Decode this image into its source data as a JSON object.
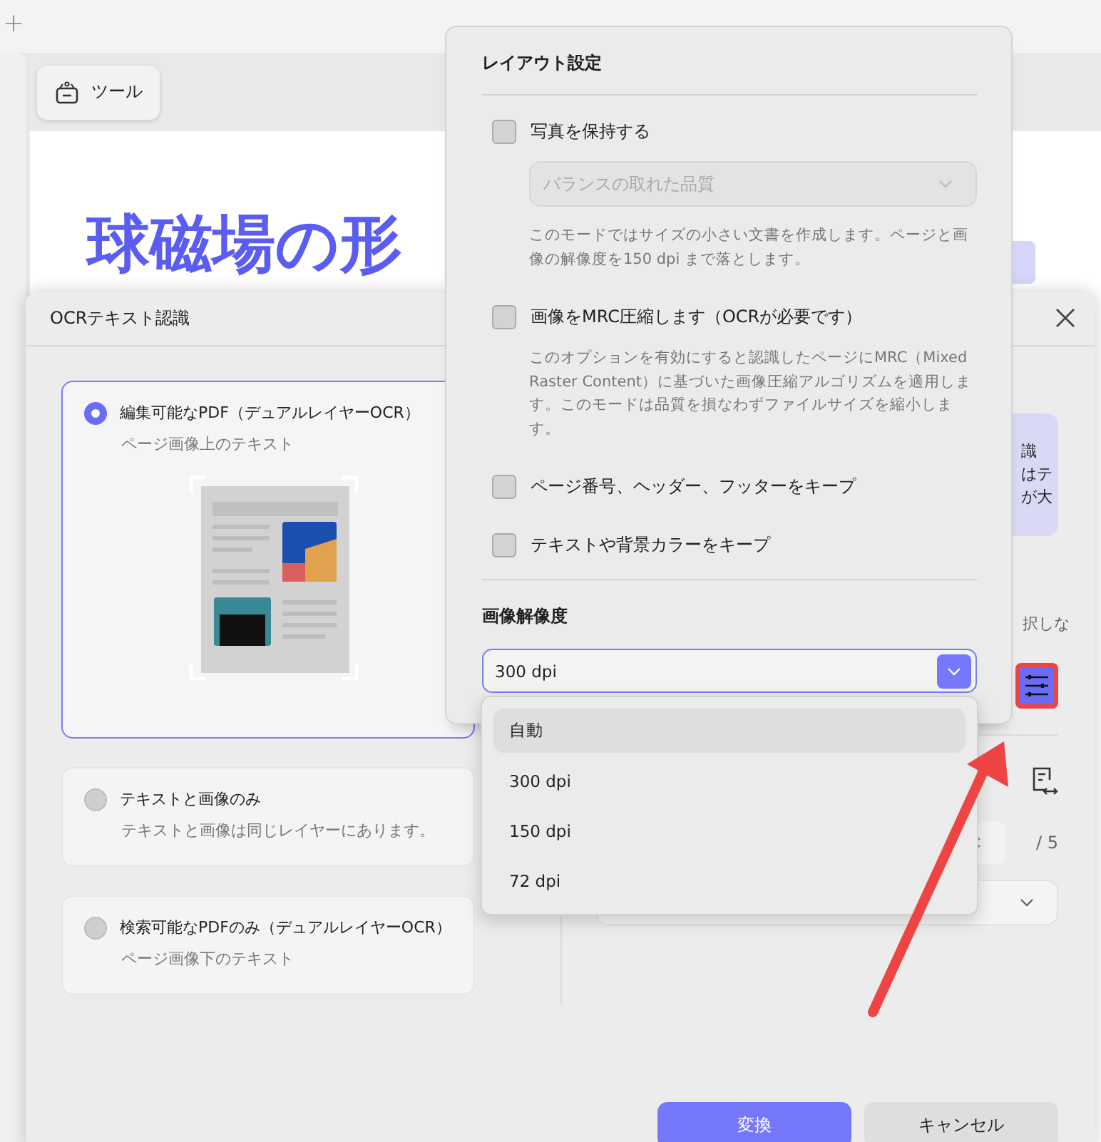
{
  "tab_strip": {
    "new_tab": "+"
  },
  "toolbar": {
    "tool_button": "ツール"
  },
  "document": {
    "heading": "球磁場の形"
  },
  "ocr_dialog": {
    "title": "OCRテキスト認識",
    "options": [
      {
        "label": "編集可能なPDF（デュアルレイヤーOCR）",
        "description": "ページ画像上のテキスト",
        "selected": true
      },
      {
        "label": "テキストと画像のみ",
        "description": "テキストと画像は同じレイヤーにあります。",
        "selected": false
      },
      {
        "label": "検索可能なPDFのみ（デュアルレイヤーOCR）",
        "description": "ページ画像下のテキスト",
        "selected": false
      }
    ],
    "side_panel": {
      "note_lines": [
        "識",
        "はテ",
        "が大"
      ],
      "hint": "択しな",
      "page_total": "/ 5"
    },
    "buttons": [
      {
        "label": "変換",
        "kind": "primary"
      },
      {
        "label": "キャンセル",
        "kind": "secondary"
      }
    ]
  },
  "layout_popup": {
    "title": "レイアウト設定",
    "options": [
      {
        "label": "写真を保持する",
        "checked": false,
        "select": {
          "value": "バランスの取れた品質",
          "disabled": true
        },
        "description": "このモードではサイズの小さい文書を作成します。ページと画像の解像度を150 dpi まで落とします。"
      },
      {
        "label": "画像をMRC圧縮します（OCRが必要です）",
        "checked": false,
        "description": "このオプションを有効にすると認識したページにMRC（Mixed Raster Content）に基づいた画像圧縮アルゴリズムを適用します。このモードは品質を損なわずファイルサイズを縮小します。"
      },
      {
        "label": "ページ番号、ヘッダー、フッターをキープ",
        "checked": false
      },
      {
        "label": "テキストや背景カラーをキープ",
        "checked": false
      }
    ],
    "resolution": {
      "label": "画像解像度",
      "value": "300 dpi",
      "expanded": true,
      "options": [
        {
          "label": "自動",
          "highlighted": true
        },
        {
          "label": "300 dpi",
          "highlighted": false
        },
        {
          "label": "150 dpi",
          "highlighted": false
        },
        {
          "label": "72 dpi",
          "highlighted": false
        }
      ]
    }
  }
}
